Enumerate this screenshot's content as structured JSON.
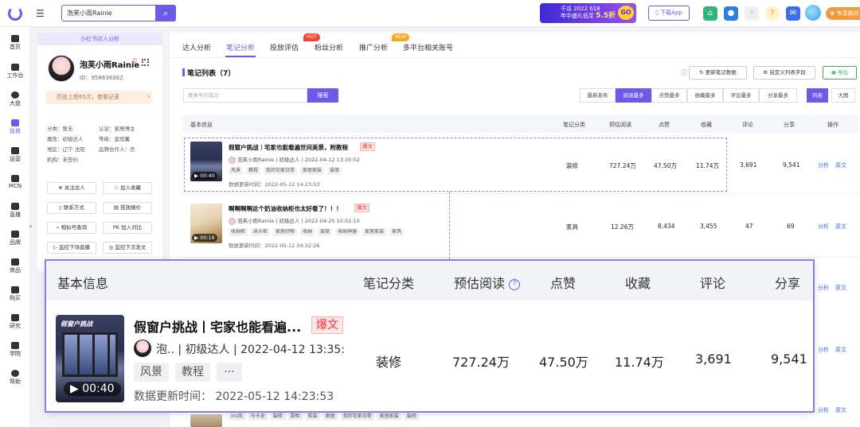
{
  "topbar": {
    "search_value": "泡芙小雨Rainie",
    "promo_line1": "千瓜 2022 618",
    "promo_line2": "年中盛礼低至",
    "promo_discount": "5.5折",
    "promo_badge": "GO",
    "download_label": "下载App",
    "vip_label": "专享顾问"
  },
  "leftnav": {
    "items": [
      "首页",
      "工作台",
      "大盘",
      "投放",
      "运营",
      "MCN",
      "直播",
      "品牌",
      "商品",
      "购买",
      "研究",
      "学院",
      "帮助"
    ],
    "active": "投放"
  },
  "profile": {
    "header": "小红书达人分析",
    "name": "泡芙小雨Rainie",
    "id": "ID：958638362",
    "history": "历史上榜65次，查看记录",
    "category": "分类：暂无",
    "cert": "认证：家居博主",
    "attr": "属性：初级达人",
    "level": "等级：金冠薯",
    "region": "地区：辽宁 沈阳",
    "brand_partner": "品牌合作人：否",
    "org": "机构：未签约",
    "buttons": [
      "关注达人",
      "加入收藏",
      "联系方式",
      "投放报价",
      "相似号查询",
      "加入对比",
      "监控下场直播",
      "监控下次发文"
    ]
  },
  "tabs": [
    {
      "label": "达人分析"
    },
    {
      "label": "笔记分析"
    },
    {
      "label": "投放评估",
      "badge": "HOT"
    },
    {
      "label": "粉丝分析"
    },
    {
      "label": "推广分析",
      "badge": "NEW"
    },
    {
      "label": "多平台相关账号"
    }
  ],
  "notes": {
    "title": "笔记列表（7）",
    "refresh_btn": "更新笔记数据",
    "custom_btn": "自定义列表字段",
    "export_btn": "导出",
    "search_placeholder": "搜索号内笔记",
    "search_btn": "搜索",
    "sort_options": [
      "最新发布",
      "阅读最多",
      "点赞最多",
      "收藏最多",
      "评论最多",
      "分享最多"
    ],
    "sort_active": "阅读最多",
    "view_options": [
      "列表",
      "大图"
    ],
    "view_active": "列表",
    "columns": [
      "基本信息",
      "笔记分类",
      "预估阅读",
      "点赞",
      "收藏",
      "评论",
      "分享",
      "操作"
    ],
    "ops": [
      "分析",
      "原文"
    ],
    "rows": [
      {
        "title": "假窗户挑战｜宅家也能看遍世间美景，附教程",
        "hot": "爆文",
        "author": "泡芙小雨Rainie",
        "author_level": "初级达人",
        "time": "2022-04-12 13:35:52",
        "tags": [
          "风景",
          "教程",
          "我的宅家日常",
          "家居家装",
          "装修"
        ],
        "updated": "数据更新时间：2022-05-12 14:23:53",
        "duration": "00:40",
        "category": "装修",
        "reads": "727.24万",
        "likes": "47.50万",
        "collects": "11.74万",
        "comments": "3,691",
        "shares": "9,541"
      },
      {
        "title": "啊啊啊啊这个奶油收纳柜也太好看了！！！",
        "hot": "爆文",
        "author": "泡芙小雨Rainie",
        "author_level": "初级达人",
        "time": "2022-04-25 10:02:10",
        "tags": [
          "收纳柜",
          "床头柜",
          "家居好物",
          "收纳",
          "装修",
          "收纳神器",
          "家居家装",
          "家具"
        ],
        "updated": "数据更新时间：2022-05-12 04:32:26",
        "duration": "00:16",
        "category": "家具",
        "reads": "12.26万",
        "likes": "8,434",
        "collects": "3,455",
        "comments": "47",
        "shares": "69"
      },
      {
        "tags": [
          "ins风",
          "马卡龙",
          "装修",
          "厨柜",
          "软装",
          "家居",
          "我的宅家日常",
          "家居家装",
          "装修"
        ]
      }
    ]
  },
  "zoom": {
    "columns": [
      "基本信息",
      "笔记分类",
      "预估阅读",
      "点赞",
      "收藏",
      "评论",
      "分享"
    ],
    "title": "假窗户挑战丨宅家也能看遍...",
    "hot": "爆文",
    "author": "泡..",
    "author_rest": "| 初级达人 | 2022-04-12 13:35:5",
    "tags": [
      "风景",
      "教程",
      "···"
    ],
    "updated": "数据更新时间：  2022-05-12 14:23:53",
    "duration": "00:40",
    "thumb_label": "假窗户挑战",
    "category": "装修",
    "reads": "727.24万",
    "likes": "47.50万",
    "collects": "11.74万",
    "comments": "3,691",
    "shares": "9,541"
  },
  "colors": {
    "accent": "#6b5be8",
    "hot": "#e33333",
    "link": "#3b6ee8"
  }
}
